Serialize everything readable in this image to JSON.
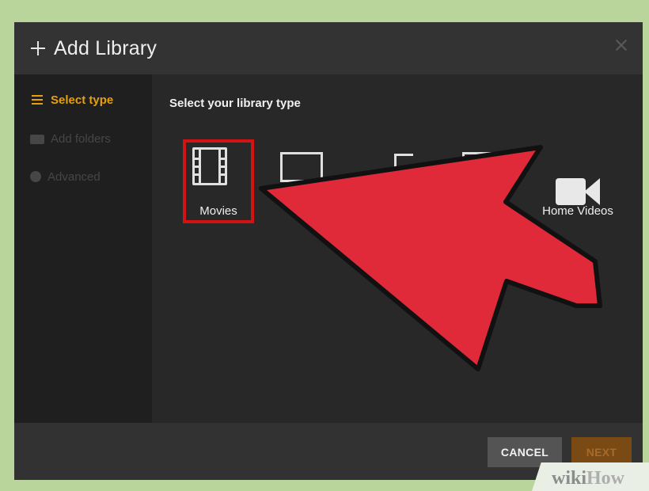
{
  "dialog": {
    "title": "Add Library"
  },
  "sidebar": {
    "items": [
      {
        "label": "Select type",
        "icon": "list-icon",
        "state": "active"
      },
      {
        "label": "Add folders",
        "icon": "folder-icon",
        "state": "disabled"
      },
      {
        "label": "Advanced",
        "icon": "gear-icon",
        "state": "disabled"
      }
    ]
  },
  "main": {
    "prompt": "Select your library type",
    "types": [
      {
        "label": "Movies",
        "icon": "film-icon",
        "highlighted": true
      },
      {
        "label": "Home Videos",
        "icon": "video-camera-icon"
      }
    ]
  },
  "footer": {
    "cancel_label": "CANCEL",
    "next_label": "NEXT"
  },
  "watermark": {
    "wiki": "wiki",
    "how": "How"
  },
  "colors": {
    "accent": "#e5a00d",
    "highlight_box": "#d31313",
    "arrow": "#e02a3a"
  }
}
